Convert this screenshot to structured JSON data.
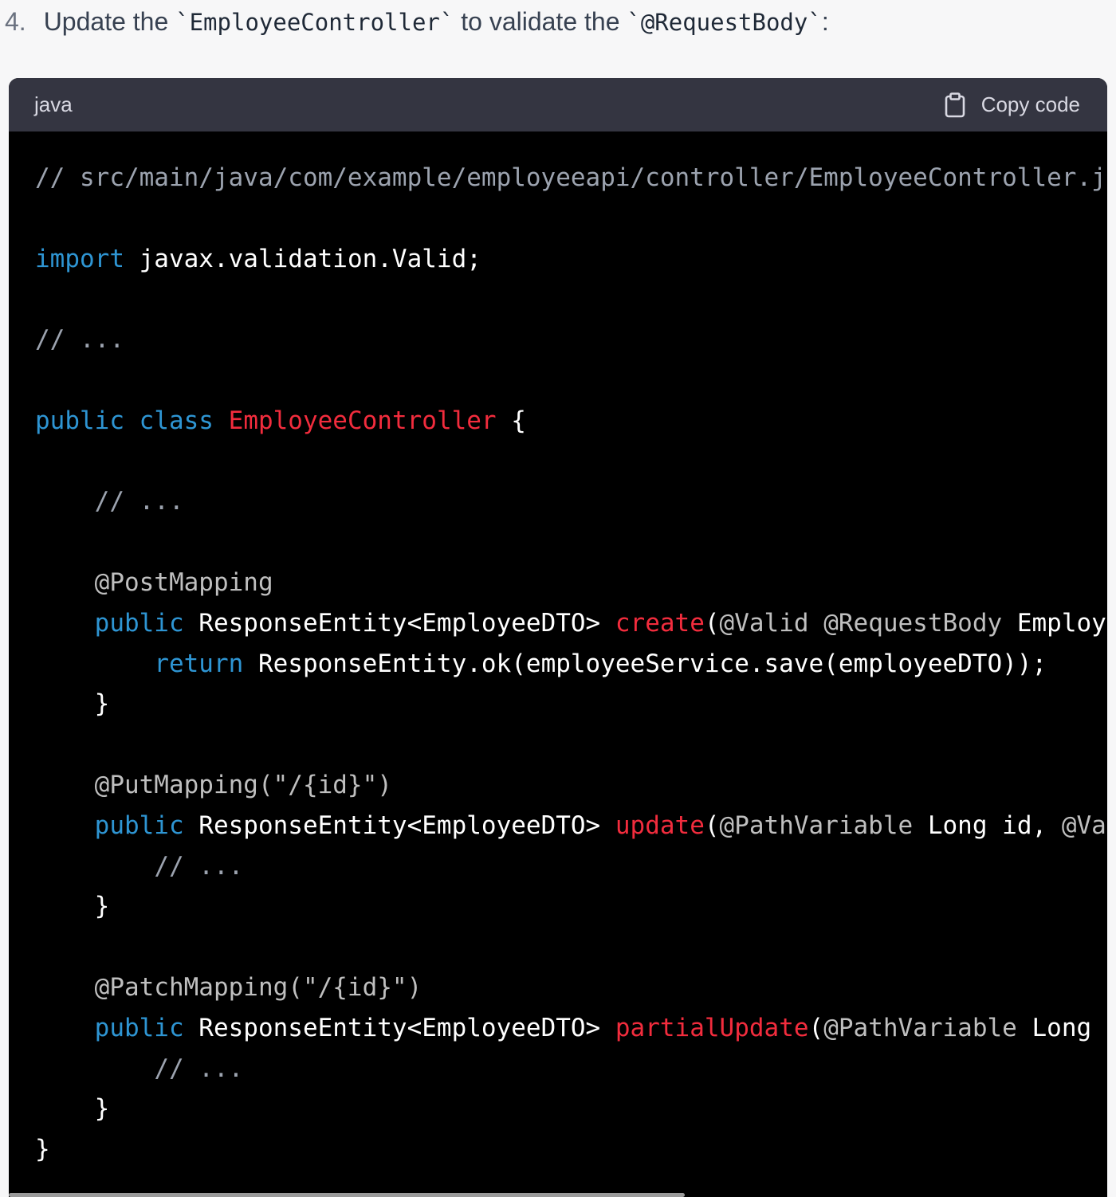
{
  "instruction": {
    "number": "4.",
    "text_before": "Update the",
    "code_1": "`EmployeeController`",
    "text_middle": "to validate the",
    "code_2": "`@RequestBody`",
    "text_after": ":"
  },
  "code_block": {
    "language": "java",
    "copy_label": "Copy code",
    "copy_icon": "clipboard-icon",
    "colors": {
      "comment": "#9ca3af",
      "keyword": "#2e95d3",
      "title": "#f22c3d",
      "annotation": "#bfbfbf",
      "plain": "#ffffff",
      "background": "#000000",
      "header": "#343541"
    },
    "lines": [
      [
        {
          "t": "// src/main/java/com/example/employeeapi/controller/EmployeeController.java",
          "c": "comment"
        }
      ],
      [],
      [
        {
          "t": "import",
          "c": "kw"
        },
        {
          "t": " javax.validation.Valid;",
          "c": "plain"
        }
      ],
      [],
      [
        {
          "t": "// ...",
          "c": "comment"
        }
      ],
      [],
      [
        {
          "t": "public",
          "c": "kw"
        },
        {
          "t": " ",
          "c": "plain"
        },
        {
          "t": "class",
          "c": "kw"
        },
        {
          "t": " ",
          "c": "plain"
        },
        {
          "t": "EmployeeController",
          "c": "title"
        },
        {
          "t": " {",
          "c": "plain"
        }
      ],
      [],
      [
        {
          "t": "    ",
          "c": "plain"
        },
        {
          "t": "// ...",
          "c": "comment"
        }
      ],
      [],
      [
        {
          "t": "    ",
          "c": "plain"
        },
        {
          "t": "@PostMapping",
          "c": "anno"
        }
      ],
      [
        {
          "t": "    ",
          "c": "plain"
        },
        {
          "t": "public",
          "c": "kw"
        },
        {
          "t": " ResponseEntity<EmployeeDTO> ",
          "c": "plain"
        },
        {
          "t": "create",
          "c": "title"
        },
        {
          "t": "(",
          "c": "plain"
        },
        {
          "t": "@Valid",
          "c": "anno"
        },
        {
          "t": " ",
          "c": "plain"
        },
        {
          "t": "@RequestBody",
          "c": "anno"
        },
        {
          "t": " EmployeeDT",
          "c": "plain"
        }
      ],
      [
        {
          "t": "        ",
          "c": "plain"
        },
        {
          "t": "return",
          "c": "kw"
        },
        {
          "t": " ResponseEntity.ok(employeeService.save(employeeDTO));",
          "c": "plain"
        }
      ],
      [
        {
          "t": "    }",
          "c": "plain"
        }
      ],
      [],
      [
        {
          "t": "    ",
          "c": "plain"
        },
        {
          "t": "@PutMapping(\"/{id}\")",
          "c": "anno"
        }
      ],
      [
        {
          "t": "    ",
          "c": "plain"
        },
        {
          "t": "public",
          "c": "kw"
        },
        {
          "t": " ResponseEntity<EmployeeDTO> ",
          "c": "plain"
        },
        {
          "t": "update",
          "c": "title"
        },
        {
          "t": "(",
          "c": "plain"
        },
        {
          "t": "@PathVariable",
          "c": "anno"
        },
        {
          "t": " Long id, ",
          "c": "plain"
        },
        {
          "t": "@Valid",
          "c": "anno"
        }
      ],
      [
        {
          "t": "        ",
          "c": "plain"
        },
        {
          "t": "// ...",
          "c": "comment"
        }
      ],
      [
        {
          "t": "    }",
          "c": "plain"
        }
      ],
      [],
      [
        {
          "t": "    ",
          "c": "plain"
        },
        {
          "t": "@PatchMapping(\"/{id}\")",
          "c": "anno"
        }
      ],
      [
        {
          "t": "    ",
          "c": "plain"
        },
        {
          "t": "public",
          "c": "kw"
        },
        {
          "t": " ResponseEntity<EmployeeDTO> ",
          "c": "plain"
        },
        {
          "t": "partialUpdate",
          "c": "title"
        },
        {
          "t": "(",
          "c": "plain"
        },
        {
          "t": "@PathVariable",
          "c": "anno"
        },
        {
          "t": " Long id,",
          "c": "plain"
        }
      ],
      [
        {
          "t": "        ",
          "c": "plain"
        },
        {
          "t": "// ...",
          "c": "comment"
        }
      ],
      [
        {
          "t": "    }",
          "c": "plain"
        }
      ],
      [
        {
          "t": "}",
          "c": "plain"
        }
      ]
    ]
  }
}
